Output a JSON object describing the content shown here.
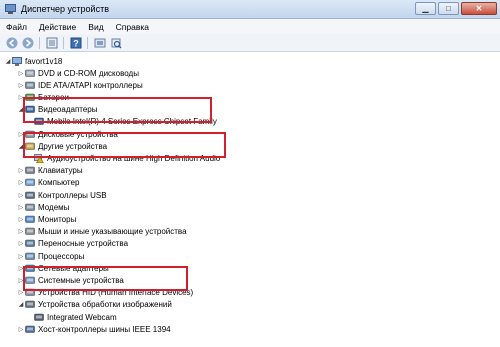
{
  "window": {
    "title": "Диспетчер устройств"
  },
  "menu": [
    "Файл",
    "Действие",
    "Вид",
    "Справка"
  ],
  "toolbar": [
    {
      "name": "back-icon"
    },
    {
      "name": "forward-icon"
    },
    {
      "name": "properties-icon"
    },
    {
      "name": "help-icon"
    },
    {
      "name": "show-hidden-icon"
    },
    {
      "name": "scan-icon"
    }
  ],
  "tree": {
    "root": "favort1v18",
    "items": [
      {
        "label": "DVD и CD-ROM дисководы",
        "arrow": "▷",
        "icon": "dvd-icon"
      },
      {
        "label": "IDE ATA/ATAPI контроллеры",
        "arrow": "▷",
        "icon": "ide-controller-icon"
      },
      {
        "label": "Батареи",
        "arrow": "▷",
        "icon": "battery-icon"
      },
      {
        "label": "Видеоадаптеры",
        "arrow": "◢",
        "icon": "display-adapter-icon"
      },
      {
        "label": "Mobile Intel(R) 4 Series Express Chipset Family",
        "arrow": "",
        "icon": "display-adapter-icon",
        "child": true
      },
      {
        "label": "Дисковые устройства",
        "arrow": "▷",
        "icon": "disk-drive-icon"
      },
      {
        "label": "Другие устройства",
        "arrow": "◢",
        "icon": "other-devices-icon"
      },
      {
        "label": "Аудиоустройство на шине High Definition Audio",
        "arrow": "",
        "icon": "warning-device-icon",
        "child": true
      },
      {
        "label": "Клавиатуры",
        "arrow": "▷",
        "icon": "keyboard-icon"
      },
      {
        "label": "Компьютер",
        "arrow": "▷",
        "icon": "computer-icon"
      },
      {
        "label": "Контроллеры USB",
        "arrow": "▷",
        "icon": "usb-icon"
      },
      {
        "label": "Модемы",
        "arrow": "▷",
        "icon": "modem-icon"
      },
      {
        "label": "Мониторы",
        "arrow": "▷",
        "icon": "monitor-icon"
      },
      {
        "label": "Мыши и иные указывающие устройства",
        "arrow": "▷",
        "icon": "mouse-icon"
      },
      {
        "label": "Переносные устройства",
        "arrow": "▷",
        "icon": "portable-device-icon"
      },
      {
        "label": "Процессоры",
        "arrow": "▷",
        "icon": "processor-icon"
      },
      {
        "label": "Сетевые адаптеры",
        "arrow": "▷",
        "icon": "network-adapter-icon"
      },
      {
        "label": "Системные устройства",
        "arrow": "▷",
        "icon": "system-device-icon"
      },
      {
        "label": "Устройства HID (Human Interface Devices)",
        "arrow": "▷",
        "icon": "hid-icon"
      },
      {
        "label": "Устройства обработки изображений",
        "arrow": "◢",
        "icon": "imaging-device-icon"
      },
      {
        "label": "Integrated Webcam",
        "arrow": "",
        "icon": "webcam-icon",
        "child": true
      },
      {
        "label": "Хост-контроллеры шины IEEE 1394",
        "arrow": "▷",
        "icon": "ieee1394-icon"
      }
    ]
  },
  "highlight_color": "#d0202e"
}
